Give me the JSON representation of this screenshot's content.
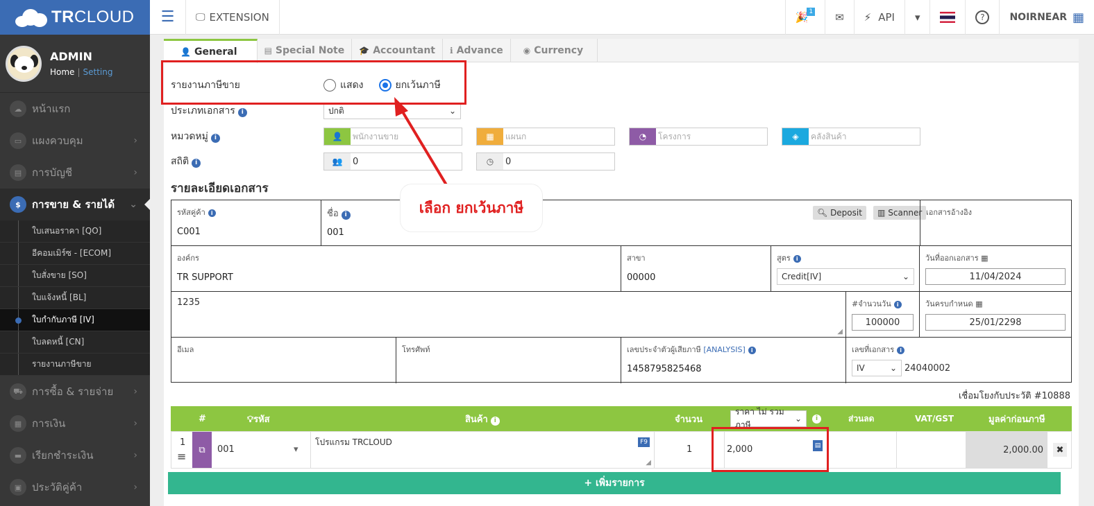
{
  "brand": {
    "name_bold": "TR",
    "name_rest": "CLOUD"
  },
  "user": {
    "name": "ADMIN",
    "home": "Home",
    "sep": "|",
    "setting": "Setting"
  },
  "nav": {
    "items": [
      {
        "label": "หน้าแรก",
        "icon": "cloud-icon"
      },
      {
        "label": "แผงควบคุม",
        "icon": "monitor-icon"
      },
      {
        "label": "การบัญชี",
        "icon": "book-icon"
      },
      {
        "label": "การขาย & รายได้",
        "icon": "dollar-icon"
      },
      {
        "label": "การซื้อ & รายจ่าย",
        "icon": "cart-icon"
      },
      {
        "label": "การเงิน",
        "icon": "calendar-icon"
      },
      {
        "label": "เรียกชำระเงิน",
        "icon": "card-icon"
      },
      {
        "label": "ประวัติคู่ค้า",
        "icon": "contact-icon"
      }
    ],
    "sub": [
      "ใบเสนอราคา [QO]",
      "อีคอมเมิร์ซ - [ECOM]",
      "ใบสั่งขาย [SO]",
      "ใบแจ้งหนี้ [BL]",
      "ใบกำกับภาษี [IV]",
      "ใบลดหนี้ [CN]",
      "รายงานภาษีขาย"
    ]
  },
  "topbar": {
    "extension": "EXTENSION",
    "badge": "1",
    "api": "API",
    "company": "NOIRNEAR"
  },
  "tabs": [
    "General",
    "Special Note",
    "Accountant",
    "Advance",
    "Currency"
  ],
  "form": {
    "tax_report_label": "รายงานภาษีขาย",
    "radio_show": "แสดง",
    "radio_exclude": "ยกเว้นภาษี",
    "doc_type_label": "ประเภทเอกสาร",
    "doc_type_value": "ปกติ",
    "category_label": "หมวดหมู่",
    "ph_sales": "พนักงานขาย",
    "ph_dept": "แผนก",
    "ph_project": "โครงการ",
    "ph_warehouse": "คลังสินค้า",
    "stats_label": "สถิติ",
    "stat1": "0",
    "stat2": "0"
  },
  "doc": {
    "section_title": "รายละเอียดเอกสาร",
    "cust_code_label": "รหัสคู่ค้า",
    "cust_code": "C001",
    "name_label": "ชื่อ",
    "name": "001",
    "deposit": "Deposit",
    "scanner": "Scanner",
    "ref_label": "เอกสารอ้างอิง",
    "org_label": "องค์กร",
    "org": "TR SUPPORT",
    "branch_label": "สาขา",
    "branch": "00000",
    "formula_label": "สูตร",
    "formula": "Credit[IV]",
    "issue_date_label": "วันที่ออกเอกสาร",
    "issue_date": "11/04/2024",
    "address": "1235",
    "days_label": "#จำนวนวัน",
    "days": "100000",
    "due_label": "วันครบกำหนด",
    "due": "25/01/2298",
    "email_label": "อีเมล",
    "phone_label": "โทรศัพท์",
    "taxid_label": "เลขประจำตัวผู้เสียภาษี",
    "analysis": "[ANALYSIS]",
    "taxid": "1458795825468",
    "docno_label": "เลขที่เอกสาร",
    "docno_prefix": "IV",
    "docno": "24040002"
  },
  "history": "เชื่อมโยงกับประวัติ #10888",
  "lines": {
    "headers": {
      "num": "#",
      "code": "รหัส",
      "product": "สินค้า",
      "qty": "จำนวน",
      "price_mode": "ราคา ไม่ รวมภาษี",
      "discount": "ส่วนลด",
      "vat": "VAT/GST",
      "amount": "มูลค่าก่อนภาษี"
    },
    "row": {
      "no": "1",
      "code": "001",
      "product": "โปรแกรม TRCLOUD",
      "f9": "F9",
      "qty": "1",
      "price": "2,000",
      "amount": "2,000.00"
    },
    "add_label": "+ เพิ่มรายการ"
  },
  "annotation": {
    "callout": "เลือก ยกเว้นภาษี"
  }
}
